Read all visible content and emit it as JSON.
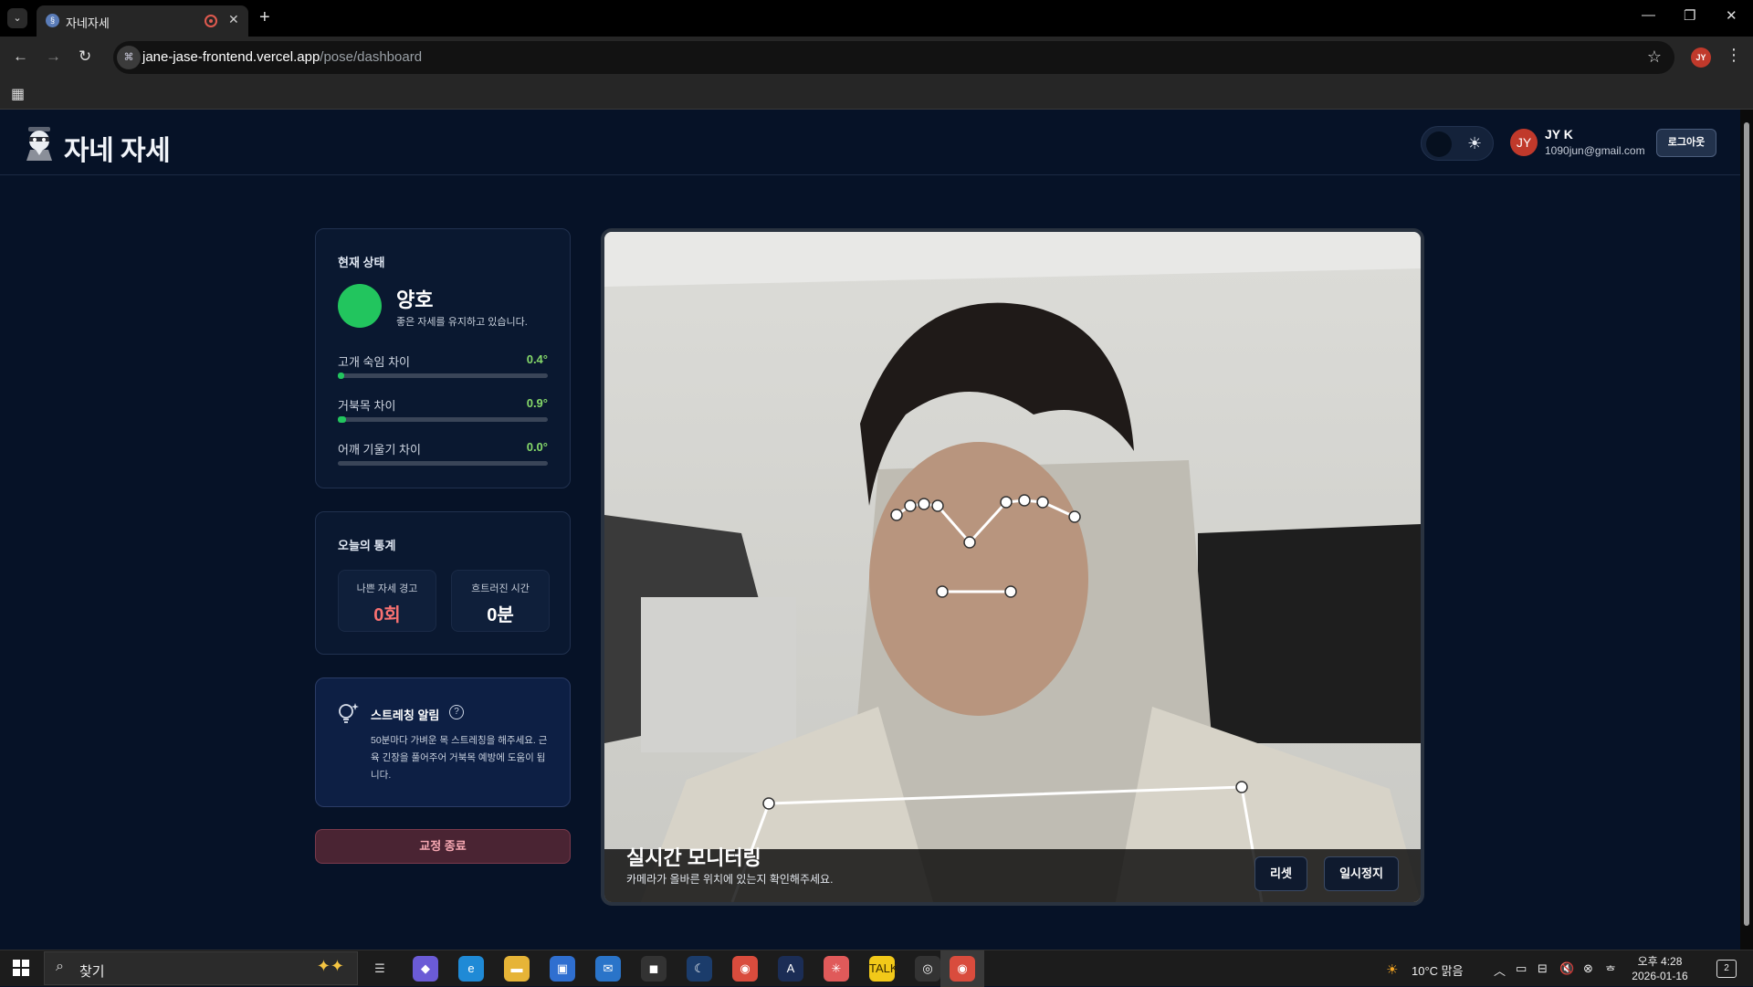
{
  "browser": {
    "tab_title": "자네자세",
    "url_host": "jane-jase-frontend.vercel.app",
    "url_path": "/pose/dashboard",
    "profile_initials": "JY"
  },
  "header": {
    "logo_text": "자네 자세",
    "user_initials": "JY",
    "user_name": "JY K",
    "user_email": "1090jun@gmail.com",
    "logout_label": "로그아웃"
  },
  "status": {
    "title": "현재 상태",
    "state_label": "양호",
    "state_desc": "좋은 자세를 유지하고 있습니다.",
    "state_color": "#22c55e",
    "metrics": [
      {
        "label": "고개 숙임 차이",
        "value": "0.4°",
        "fill": 0.03
      },
      {
        "label": "거북목 차이",
        "value": "0.9°",
        "fill": 0.04
      },
      {
        "label": "어깨 기울기 차이",
        "value": "0.0°",
        "fill": 0.0
      }
    ]
  },
  "stats": {
    "title": "오늘의 통계",
    "bad_label": "나쁜 자세 경고",
    "bad_value": "0회",
    "bad_color": "#f87171",
    "lost_label": "흐트러진 시간",
    "lost_value": "0분"
  },
  "stretch": {
    "title": "스트레칭 알림",
    "body": "50분마다 가벼운 목 스트레칭을 해주세요. 근육 긴장을 풀어주어 거북목 예방에 도움이 됩니다."
  },
  "end_button": "교정 종료",
  "camera": {
    "title": "실시간 모니터링",
    "subtitle": "카메라가 올바른 위치에 있는지 확인해주세요.",
    "reset_label": "리셋",
    "pause_label": "일시정지"
  },
  "taskbar": {
    "search_text": "찾기",
    "weather": "10°C  맑음",
    "time": "오후 4:28",
    "date": "2026-01-16",
    "notifications": "2"
  }
}
